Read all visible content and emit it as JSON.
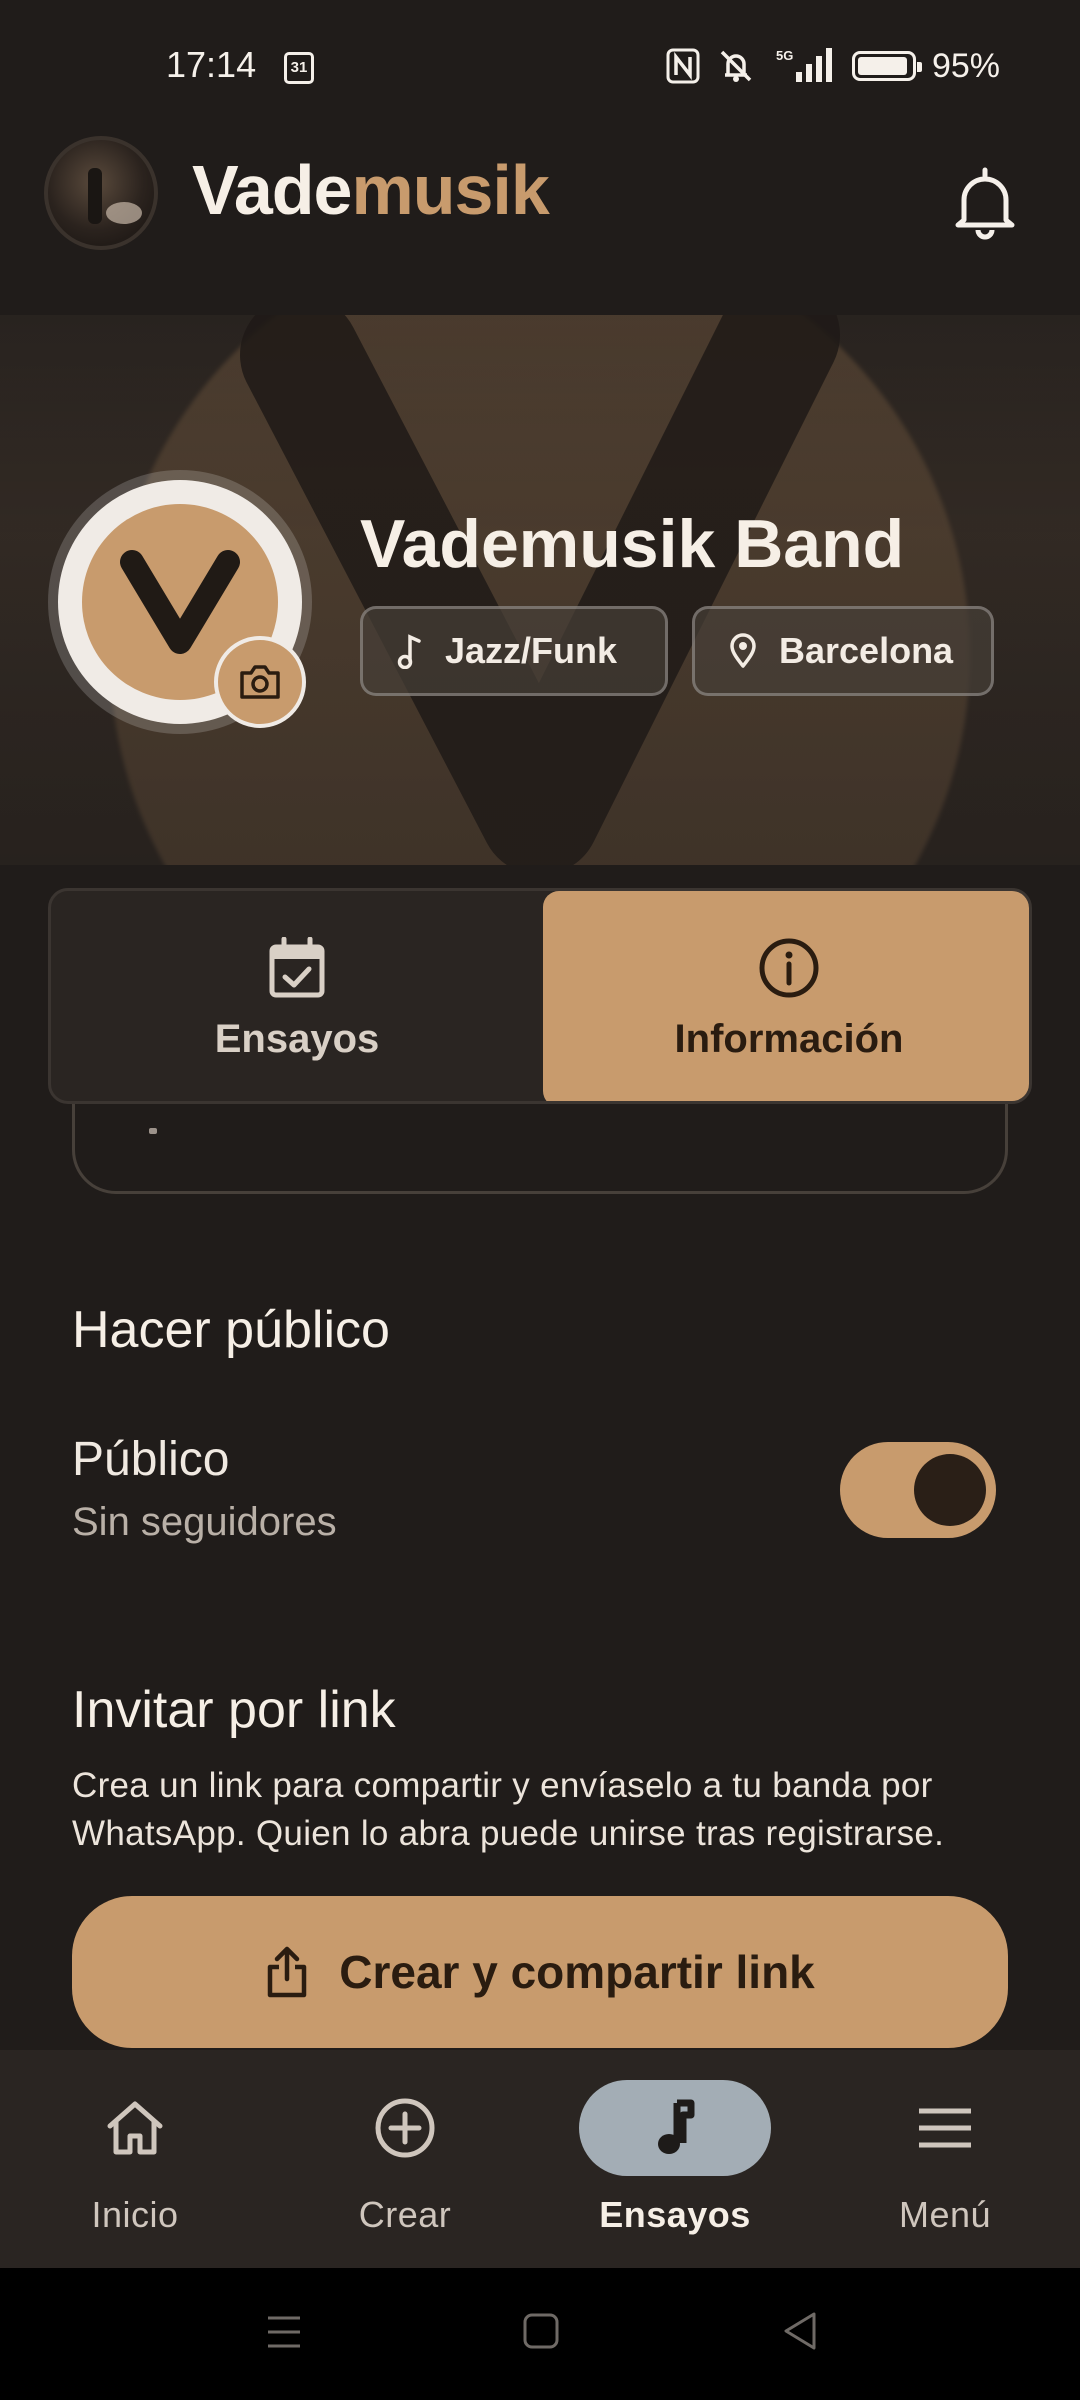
{
  "status_bar": {
    "time": "17:14",
    "calendar_day": "31",
    "network": "5G",
    "battery_percent": "95%",
    "battery_level": 0.95
  },
  "app_bar": {
    "brand_part1": "Vade",
    "brand_part2": "musik",
    "brand_accent_color": "#c89b6d"
  },
  "band": {
    "name": "Vademusik Band",
    "genre": "Jazz/Funk",
    "city": "Barcelona",
    "avatar_letter": "V"
  },
  "tabs": [
    {
      "label": "Ensayos",
      "icon": "calendar-check-icon",
      "selected": false
    },
    {
      "label": "Información",
      "icon": "info-circle-icon",
      "selected": true
    }
  ],
  "public_section": {
    "title": "Hacer público",
    "toggle_label": "Público",
    "toggle_sub": "Sin seguidores",
    "toggle_on": true
  },
  "invite_section": {
    "title": "Invitar por link",
    "description": "Crea un link para compartir y envíaselo a tu banda por WhatsApp. Quien lo abra puede unirse tras registrarse.",
    "button_label": "Crear y compartir link",
    "button_icon": "share-icon"
  },
  "bottom_nav": [
    {
      "label": "Inicio",
      "icon": "home-icon",
      "active": false
    },
    {
      "label": "Crear",
      "icon": "add-circle-icon",
      "active": false
    },
    {
      "label": "Ensayos",
      "icon": "music-note-icon",
      "active": true
    },
    {
      "label": "Menú",
      "icon": "menu-icon",
      "active": false
    }
  ],
  "colors": {
    "background": "#201c1a",
    "accent": "#c89b6d",
    "nav_active_pill": "#a3adb5"
  }
}
